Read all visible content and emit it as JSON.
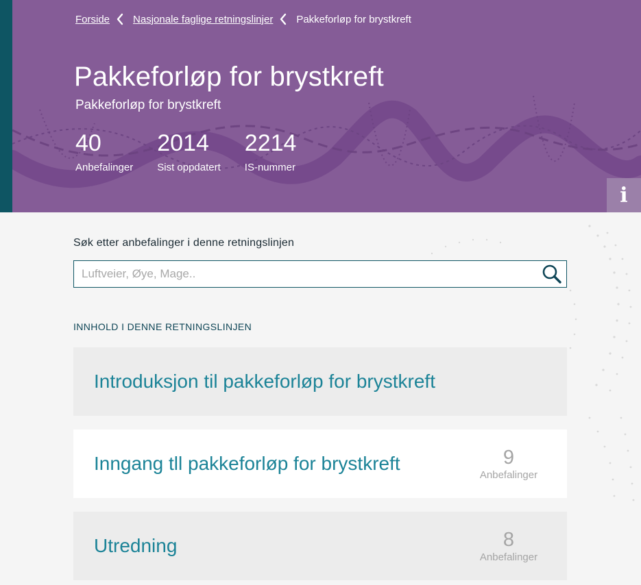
{
  "breadcrumb": {
    "items": [
      "Forside",
      "Nasjonale faglige retningslinjer"
    ],
    "current": "Pakkeforløp for brystkreft"
  },
  "header": {
    "title": "Pakkeforløp for brystkreft",
    "subtitle": "Pakkeforløp for brystkreft",
    "stats": [
      {
        "value": "40",
        "label": "Anbefalinger"
      },
      {
        "value": "2014",
        "label": "Sist oppdatert"
      },
      {
        "value": "2214",
        "label": "IS-nummer"
      }
    ],
    "info_icon": "info-icon",
    "info_glyph": "i"
  },
  "search": {
    "label": "Søk etter anbefalinger i denne retningslinjen",
    "placeholder": "Luftveier, Øye, Mage..",
    "value": "",
    "icon": "search-icon"
  },
  "contents": {
    "heading": "INNHOLD I DENNE RETNINGSLINJEN",
    "items": [
      {
        "title": "Introduksjon til pakkeforløp for brystkreft",
        "count": "",
        "count_label": ""
      },
      {
        "title": "Inngang tll pakkeforløp for brystkreft",
        "count": "9",
        "count_label": "Anbefalinger"
      },
      {
        "title": "Utredning",
        "count": "8",
        "count_label": "Anbefalinger"
      }
    ]
  },
  "colors": {
    "hero_background": "#855c97",
    "hero_stripe": "#0e5563",
    "link_teal": "#1b8397",
    "page_background": "#f5f5f5"
  }
}
